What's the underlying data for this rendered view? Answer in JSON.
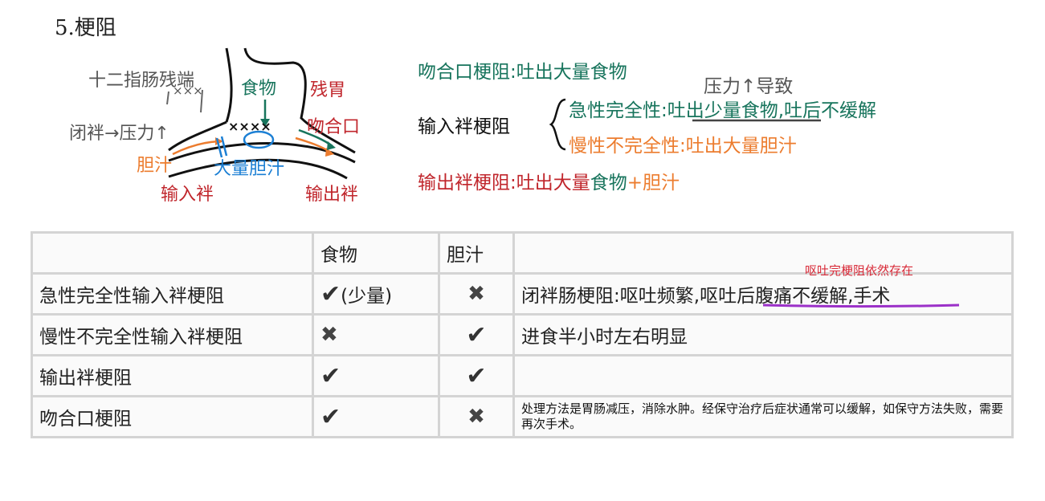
{
  "title": "5.梗阻",
  "diagram": {
    "duodenal_stump": "十二指肠残端",
    "stump_marks": "×××",
    "food": "食物",
    "remnant_stomach": "残胃",
    "anastomosis": "吻合口",
    "closed_loop": "闭袢→压力↑",
    "bile": "胆汁",
    "lots_of_bile": "大量胆汁",
    "afferent_loop": "输入袢",
    "efferent_loop": "输出袢",
    "anastomosis_marks": "××××"
  },
  "notes": {
    "anastomotic_obstruction": "吻合口梗阻:吐出大量食物",
    "pressure_note": "压力↑导致",
    "afferent_label": "输入袢梗阻",
    "acute_complete": "急性完全性:吐出少量食物,吐后不缓解",
    "chronic_incomplete": "慢性不完全性:吐出大量胆汁",
    "efferent_prefix": "输出袢梗阻:吐出大量",
    "efferent_food": "食物",
    "efferent_plus_bile": "+胆汁"
  },
  "table": {
    "headers": [
      "",
      "食物",
      "胆汁",
      ""
    ],
    "rows": [
      {
        "name": "急性完全性输入袢梗阻",
        "food": "check",
        "food_note": "(少量)",
        "bile": "cross",
        "note_a": "闭袢肠梗阻:呕吐频繁,",
        "note_b": "呕吐后腹痛不缓解",
        "note_c": ",手术"
      },
      {
        "name": "慢性不完全性输入袢梗阻",
        "food": "cross",
        "bile": "check",
        "note": "进食半小时左右明显"
      },
      {
        "name": "输出袢梗阻",
        "food": "check",
        "bile": "check",
        "note": ""
      },
      {
        "name": "吻合口梗阻",
        "food": "check",
        "bile": "cross",
        "note": "处理方法是胃肠减压，消除水肿。经保守治疗后症状通常可以缓解，如保守方法失败，需要再次手术。"
      }
    ],
    "annotation": "呕吐完梗阻依然存在"
  },
  "symbols": {
    "check": "✔",
    "cross": "✖"
  },
  "colors": {
    "green": "#17745c",
    "red": "#c0262c",
    "orange": "#ec7c2e",
    "blue": "#1b7fd4",
    "purple": "#9b30c8"
  }
}
